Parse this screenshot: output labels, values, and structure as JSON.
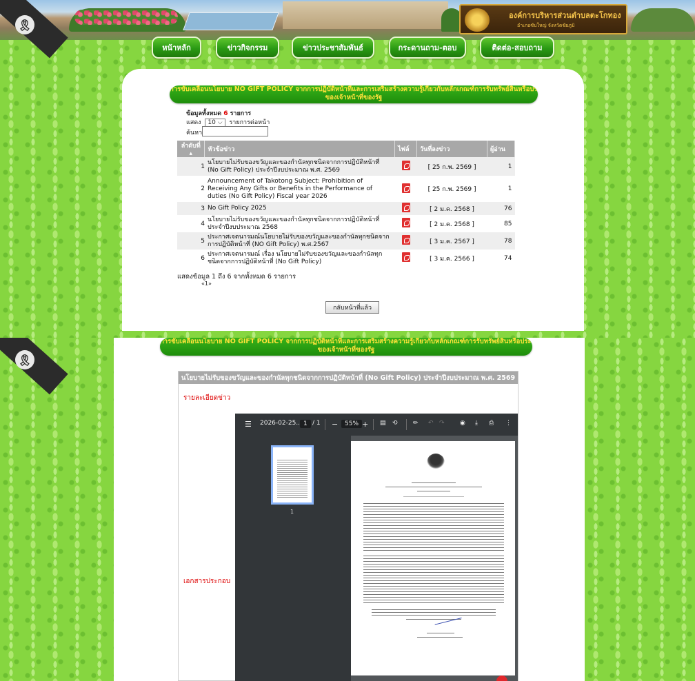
{
  "site": {
    "org_name": "องค์การบริหารส่วนตำบลตะโกทอง",
    "org_sub": "อำเภอซับใหญ่   จังหวัดชัยภูมิ",
    "ribbon_glyph": "ribbon-icon",
    "nav": [
      "หน้าหลัก",
      "ข่าวกิจกรรม",
      "ข่าวประชาสัมพันธ์",
      "กระดานถาม-ตอบ",
      "ติดต่อ-สอบถาม"
    ]
  },
  "list_page": {
    "title_line1": "การขับเคลื่อนนโยบาย NO GIFT POLICY จากการปฏิบัติหน้าที่และการเสริมสร้างความรู้เกี่ยวกับหลักเกณฑ์การรับทรัพย์สินหรือประโยชน์อื่นใดโดยธรรมจรรยา",
    "title_line2": "ของเจ้าหน้าที่ของรัฐ",
    "total_prefix": "ข้อมูลทั้งหมด",
    "total_count": "6",
    "total_suffix": "รายการ",
    "show_label": "แสดง",
    "page_size": "10",
    "per_page_label": "รายการต่อหน้า",
    "search_label": "ค้นหา",
    "columns": [
      "ลำดับที่",
      "หัวข้อข่าว",
      "ไฟล์",
      "วันที่ลงข่าว",
      "ผู้อ่าน"
    ],
    "rows": [
      {
        "no": "1",
        "title": "นโยบายไม่รับของขวัญและของกำนัลทุกชนิดจากการปฏิบัติหน้าที่ (No Gift Policy) ประจำปีงบประมาณ พ.ศ. 2569",
        "date": "[ 25 ก.พ. 2569 ]",
        "reads": "1"
      },
      {
        "no": "2",
        "title": "Announcement of Takotong Subject: Prohibition of Receiving Any Gifts or Benefits in the Performance of duties (No Gift Policy) Fiscal year 2026",
        "date": "[ 25 ก.พ. 2569 ]",
        "reads": "1"
      },
      {
        "no": "3",
        "title": "No Gift Policy 2025",
        "date": "[ 2 ม.ค. 2568 ]",
        "reads": "76"
      },
      {
        "no": "4",
        "title": "นโยบายไม่รับของขวัญและของกำนัลทุกชนิดจากการปฏิบัติหน้าที่ ประจำปีงบประมาณ 2568",
        "date": "[ 2 ม.ค. 2568 ]",
        "reads": "85"
      },
      {
        "no": "5",
        "title": "ประกาศเจตนารมณ์นโยบายไม่รับของขวัญและของกำนัลทุกชนิดจากการปฏิบัติหน้าที่ (NO Gift Policy) พ.ศ.2567",
        "date": "[ 3 ม.ค. 2567 ]",
        "reads": "78"
      },
      {
        "no": "6",
        "title": "ประกาศเจตนารมณ์ เรื่อง นโยบายไม่รับของขวัญและของกำนัลทุกชนิดจากการปฏิบัติหน้าที่ (No Gift Policy)",
        "date": "[ 3 ม.ค. 2566 ]",
        "reads": "74"
      }
    ],
    "showing": "แสดงข้อมูล 1 ถึง 6 จากทั้งหมด 6 รายการ",
    "pager": "«1»",
    "back_button": "กลับหน้าที่แล้ว"
  },
  "detail_page": {
    "heading": "นโยบายไม่รับของขวัญและของกำนัลทุกชนิดจากการปฏิบัติหน้าที่ (No Gift Policy) ประจำปีงบประมาณ พ.ศ. 2569",
    "detail_label": "รายละเอียดข่าว",
    "attachment_label": "เอกสารประกอบ",
    "viewer": {
      "filename": "2026-02-25...",
      "page_current": "1",
      "page_total": "/ 1",
      "zoom": "55%",
      "thumb_page": "1"
    }
  }
}
